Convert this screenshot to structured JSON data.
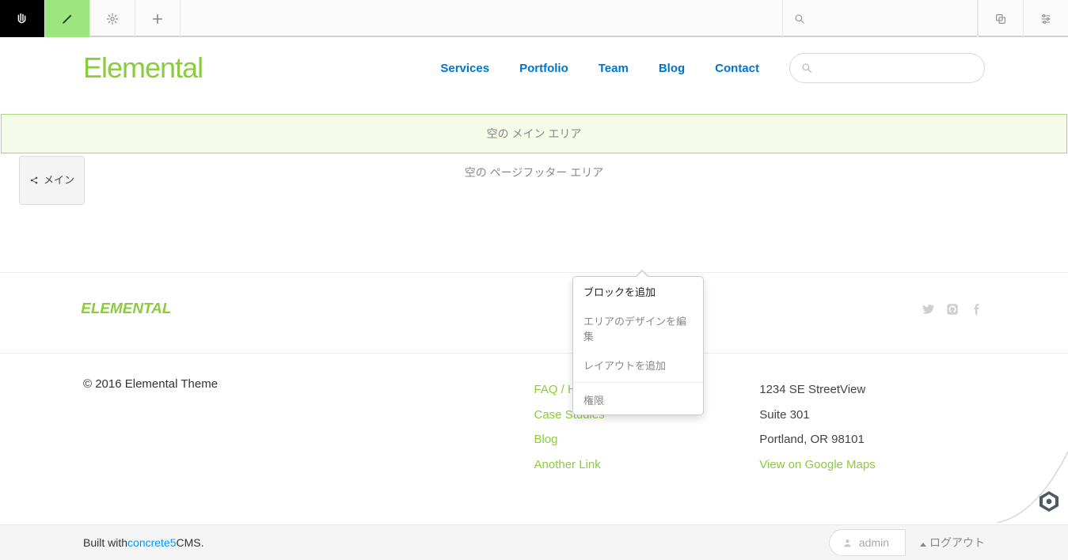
{
  "adminbar": {
    "search_placeholder": ""
  },
  "site": {
    "logo": "Elemental",
    "nav": [
      "Services",
      "Portfolio",
      "Team",
      "Blog",
      "Contact"
    ]
  },
  "areas": {
    "main_empty": "空の メイン エリア",
    "footer_empty": "空の ページフッター エリア",
    "main_label": "メイン"
  },
  "popover": {
    "add_block": "ブロックを追加",
    "edit_design": "エリアのデザインを編集",
    "add_layout": "レイアウトを追加",
    "permissions": "権限"
  },
  "footer": {
    "logo": "ELEMENTAL",
    "copyright": "© 2016 Elemental Theme",
    "links": [
      "FAQ / Help",
      "Case Studies",
      "Blog",
      "Another Link"
    ],
    "address": [
      "1234 SE StreetView",
      "Suite 301",
      "Portland, OR 98101"
    ],
    "map_link": "View on Google Maps"
  },
  "bottom": {
    "built_pre": "Built with ",
    "built_link": "concrete5",
    "built_post": " CMS.",
    "user": "admin",
    "logout": "ログアウト"
  }
}
